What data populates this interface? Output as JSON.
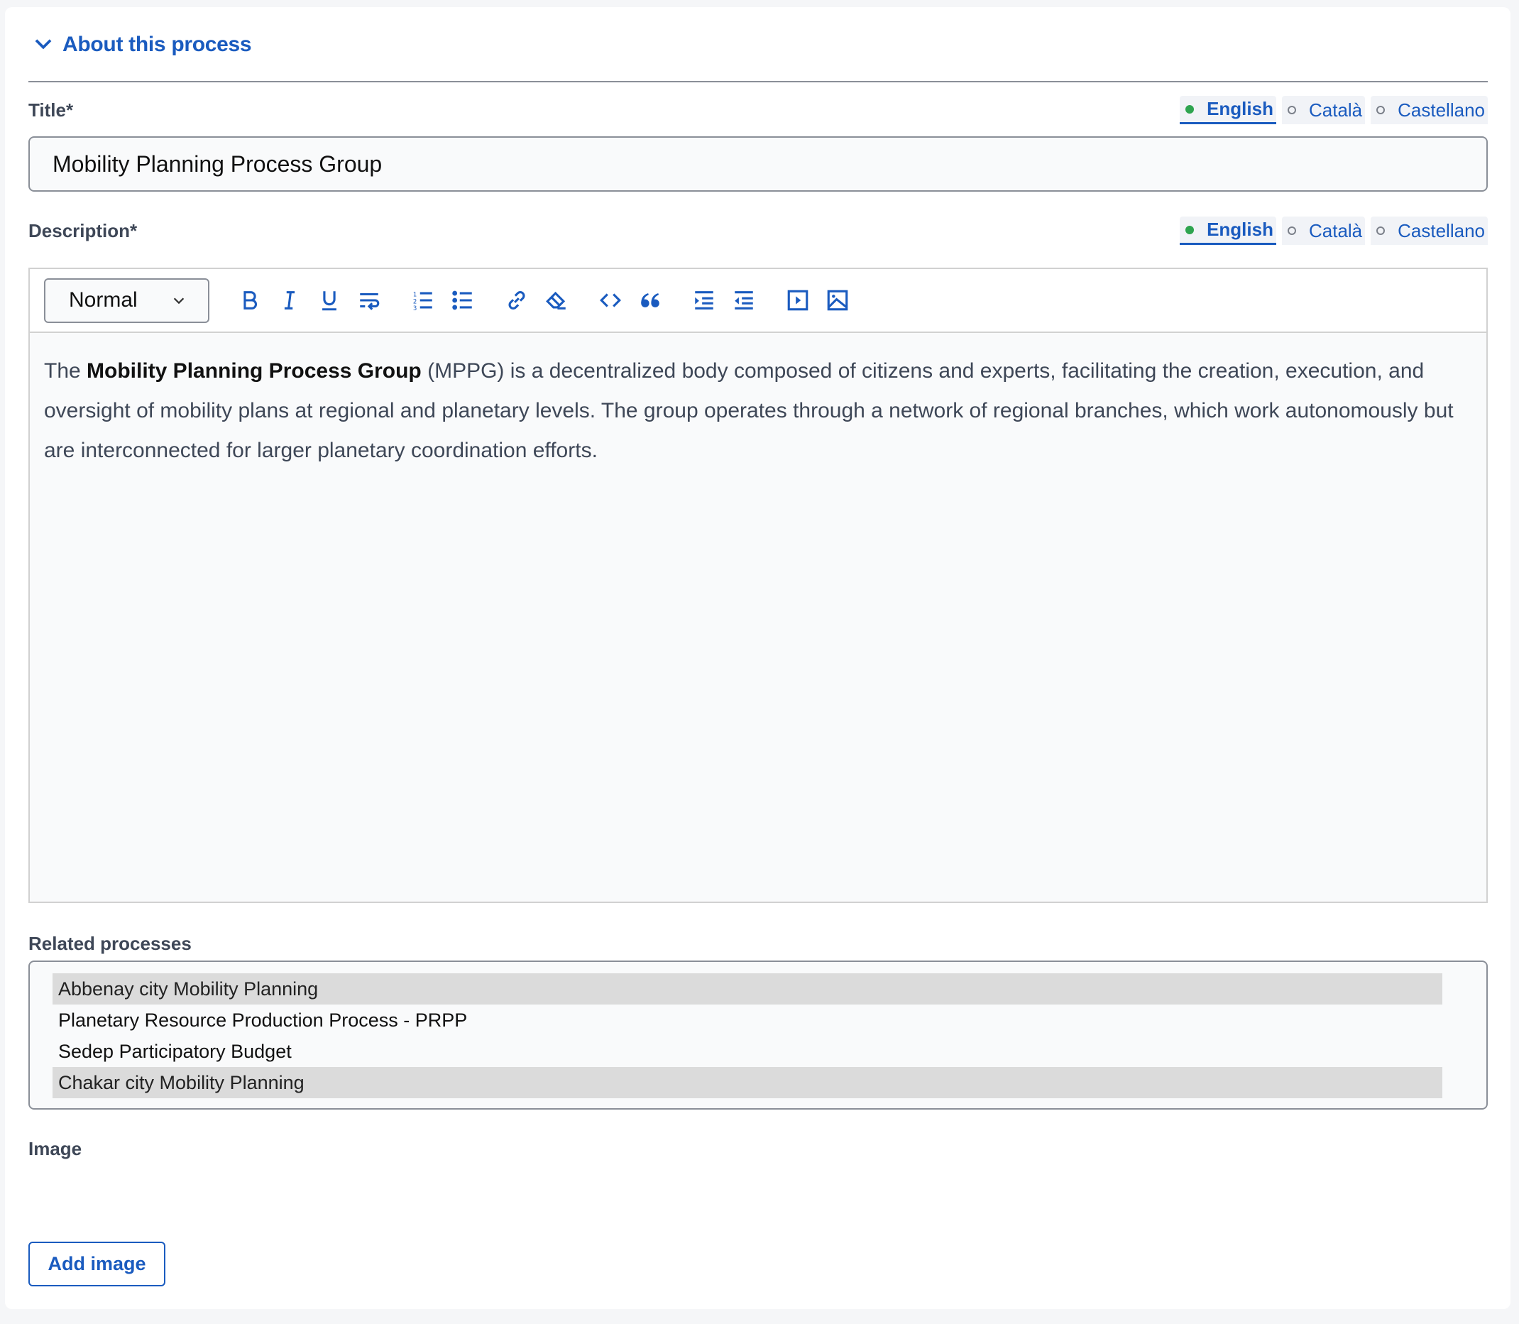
{
  "section": {
    "title": "About this process",
    "toggle_icon": "chevron-down-icon"
  },
  "title_field": {
    "label": "Title*",
    "value": "Mobility Planning Process Group",
    "languages": [
      {
        "label": "English",
        "active": true,
        "status": "filled"
      },
      {
        "label": "Català",
        "active": false,
        "status": "empty"
      },
      {
        "label": "Castellano",
        "active": false,
        "status": "empty"
      }
    ]
  },
  "description_field": {
    "label": "Description*",
    "languages": [
      {
        "label": "English",
        "active": true,
        "status": "filled"
      },
      {
        "label": "Català",
        "active": false,
        "status": "empty"
      },
      {
        "label": "Castellano",
        "active": false,
        "status": "empty"
      }
    ],
    "toolbar": {
      "format_select": "Normal",
      "buttons": [
        "bold-icon",
        "italic-icon",
        "underline-icon",
        "hard-break-icon",
        "ordered-list-icon",
        "bullet-list-icon",
        "link-icon",
        "clear-formatting-icon",
        "code-block-icon",
        "blockquote-icon",
        "indent-icon",
        "outdent-icon",
        "video-icon",
        "image-icon"
      ]
    },
    "content": {
      "prefix": "The ",
      "bold": "Mobility Planning Process Group",
      "suffix": " (MPPG) is a decentralized body composed of citizens and experts, facilitating the creation, execution, and oversight of mobility plans at regional and planetary levels. The group operates through a network of regional branches, which work autonomously but are interconnected for larger planetary coordination efforts."
    }
  },
  "related_processes": {
    "label": "Related processes",
    "options": [
      {
        "label": "Abbenay city Mobility Planning",
        "selected": true
      },
      {
        "label": "Planetary Resource Production Process - PRPP",
        "selected": false
      },
      {
        "label": "Sedep Participatory Budget",
        "selected": false
      },
      {
        "label": "Chakar city Mobility Planning",
        "selected": true
      }
    ]
  },
  "image_field": {
    "label": "Image",
    "add_button": "Add image"
  },
  "colors": {
    "accent": "#1a5bbf",
    "filled_dot": "#2ea44f",
    "selected_option": "#dbdbdb"
  }
}
